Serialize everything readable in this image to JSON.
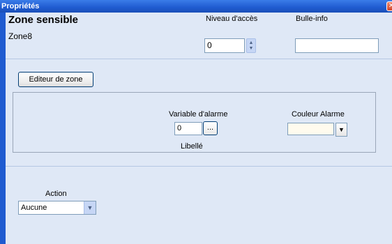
{
  "window": {
    "title": "Propriétés"
  },
  "header": {
    "title": "Zone sensible",
    "zone_name": "Zone8",
    "niveau_label": "Niveau d'accès",
    "niveau_value": "0",
    "bulle_label": "Bulle-info",
    "bulle_value": ""
  },
  "editor": {
    "button_label": "Editeur de zone"
  },
  "alarm": {
    "variable_label": "Variable d'alarme",
    "variable_value": "0",
    "browse_label": "...",
    "libelle_label": "Libellé",
    "couleur_label": "Couleur Alarme",
    "couleur_value": "#fffbee"
  },
  "action": {
    "label": "Action",
    "selected": "Aucune"
  },
  "icons": {
    "close": "close-icon",
    "spin_up": "chevron-up-icon",
    "spin_down": "chevron-down-icon",
    "dropdown": "chevron-down-icon"
  },
  "colors": {
    "titlebar": "#1f5bd0",
    "background": "#dfe8f6"
  }
}
